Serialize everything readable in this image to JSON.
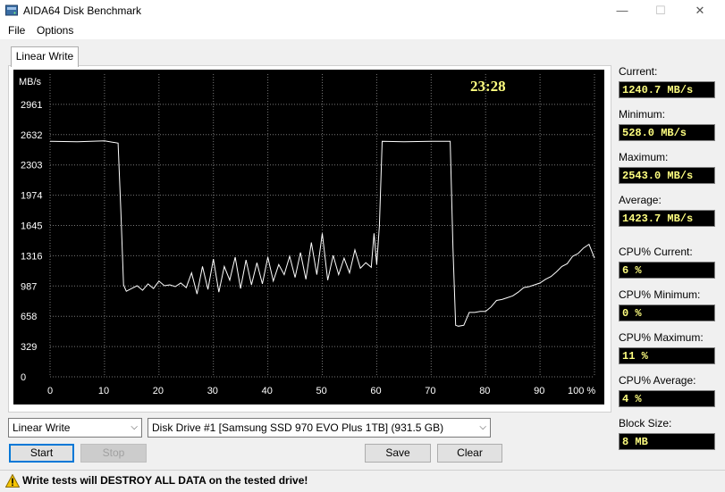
{
  "window": {
    "title": "AIDA64 Disk Benchmark",
    "minimize": "—",
    "maximize": "☐",
    "close": "✕"
  },
  "menu": {
    "file": "File",
    "options": "Options"
  },
  "tab": {
    "label": "Linear Write"
  },
  "graph": {
    "clock": "23:28",
    "unit": "MB/s",
    "bg_color": "#000000",
    "line_color": "#ffffff",
    "clock_color": "#ffff80"
  },
  "chart_data": {
    "type": "line",
    "title": "",
    "xlabel": "",
    "ylabel": "MB/s",
    "ylim": [
      0,
      3290
    ],
    "xlim": [
      0,
      100
    ],
    "y_ticks": [
      "0",
      "329",
      "658",
      "987",
      "1316",
      "1645",
      "1974",
      "2303",
      "2632",
      "2961"
    ],
    "y_tick_values": [
      0,
      329,
      658,
      987,
      1316,
      1645,
      1974,
      2303,
      2632,
      2961
    ],
    "x_ticks": [
      "0",
      "10",
      "20",
      "30",
      "40",
      "50",
      "60",
      "70",
      "80",
      "90",
      "100 %"
    ],
    "x_tick_values": [
      0,
      10,
      20,
      30,
      40,
      50,
      60,
      70,
      80,
      90,
      100
    ],
    "grid": true,
    "series": [
      {
        "x": [
          0,
          5,
          10,
          12.5,
          13,
          13.5,
          14,
          15,
          16,
          17,
          18,
          19,
          20,
          21,
          22,
          23,
          24,
          25,
          26,
          27,
          28,
          29,
          30,
          31,
          32,
          33,
          34,
          35,
          36,
          37,
          38,
          39,
          40,
          41,
          42,
          43,
          44,
          45,
          46,
          47,
          48,
          49,
          50,
          51,
          52,
          53,
          54,
          55,
          56,
          57,
          58,
          59,
          59.5,
          60,
          60.5,
          61,
          65,
          70,
          73.5,
          74,
          74.5,
          75,
          76,
          77,
          78,
          79,
          80,
          81,
          82,
          83,
          84,
          85,
          86,
          87,
          88,
          89,
          90,
          91,
          92,
          93,
          94,
          95,
          96,
          97,
          98,
          99,
          100
        ],
        "y": [
          2560,
          2555,
          2565,
          2540,
          1800,
          1000,
          930,
          960,
          990,
          940,
          1010,
          960,
          1040,
          990,
          1000,
          980,
          1020,
          970,
          1130,
          900,
          1200,
          950,
          1280,
          920,
          1200,
          1050,
          1300,
          960,
          1270,
          1000,
          1240,
          1010,
          1300,
          1040,
          1220,
          1110,
          1310,
          1080,
          1350,
          1060,
          1460,
          1110,
          1560,
          1050,
          1320,
          1110,
          1290,
          1130,
          1380,
          1180,
          1240,
          1190,
          1560,
          1220,
          1640,
          2560,
          2555,
          2560,
          2560,
          1400,
          560,
          550,
          560,
          700,
          700,
          710,
          710,
          760,
          830,
          840,
          860,
          880,
          920,
          970,
          980,
          1000,
          1020,
          1060,
          1090,
          1140,
          1200,
          1230,
          1310,
          1340,
          1400,
          1440,
          1290
        ]
      }
    ]
  },
  "stats": {
    "current": {
      "label": "Current:",
      "value": "1240.7 MB/s"
    },
    "minimum": {
      "label": "Minimum:",
      "value": "528.0 MB/s"
    },
    "maximum": {
      "label": "Maximum:",
      "value": "2543.0 MB/s"
    },
    "average": {
      "label": "Average:",
      "value": "1423.7 MB/s"
    },
    "cpu_current": {
      "label": "CPU% Current:",
      "value": "6 %"
    },
    "cpu_minimum": {
      "label": "CPU% Minimum:",
      "value": "0 %"
    },
    "cpu_maximum": {
      "label": "CPU% Maximum:",
      "value": "11 %"
    },
    "cpu_average": {
      "label": "CPU% Average:",
      "value": "4 %"
    },
    "block_size": {
      "label": "Block Size:",
      "value": "8 MB"
    }
  },
  "controls": {
    "test_select": "Linear Write",
    "drive_select": "Disk Drive #1  [Samsung SSD 970 EVO Plus 1TB]  (931.5 GB)",
    "start": "Start",
    "stop": "Stop",
    "save": "Save",
    "clear": "Clear"
  },
  "status": {
    "warning": "Write tests will DESTROY ALL DATA on the tested drive!"
  }
}
